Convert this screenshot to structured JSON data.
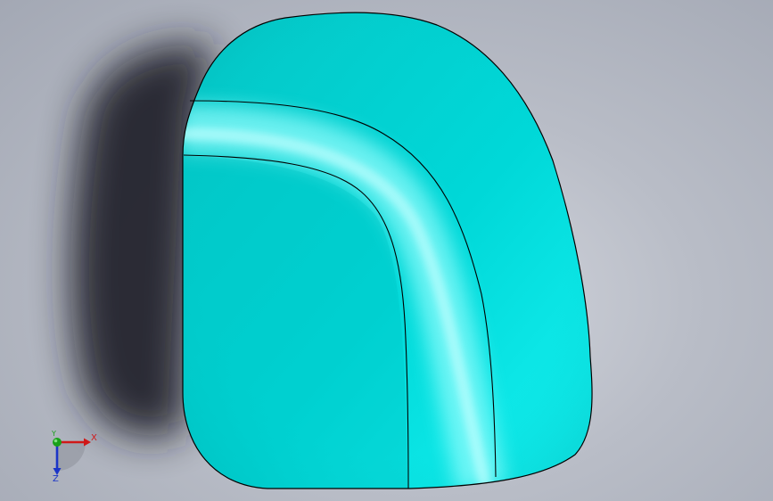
{
  "viewport": {
    "background_color": "#b9bdc7",
    "model": {
      "face_color": "#00d4d4",
      "highlight_color": "#7ffcfc",
      "edge_color": "#000000"
    },
    "triad": {
      "x_label": "X",
      "y_label": "Y",
      "z_label": "Z",
      "x_color": "#d01818",
      "y_color": "#18a018",
      "z_color": "#1b35c8"
    }
  }
}
